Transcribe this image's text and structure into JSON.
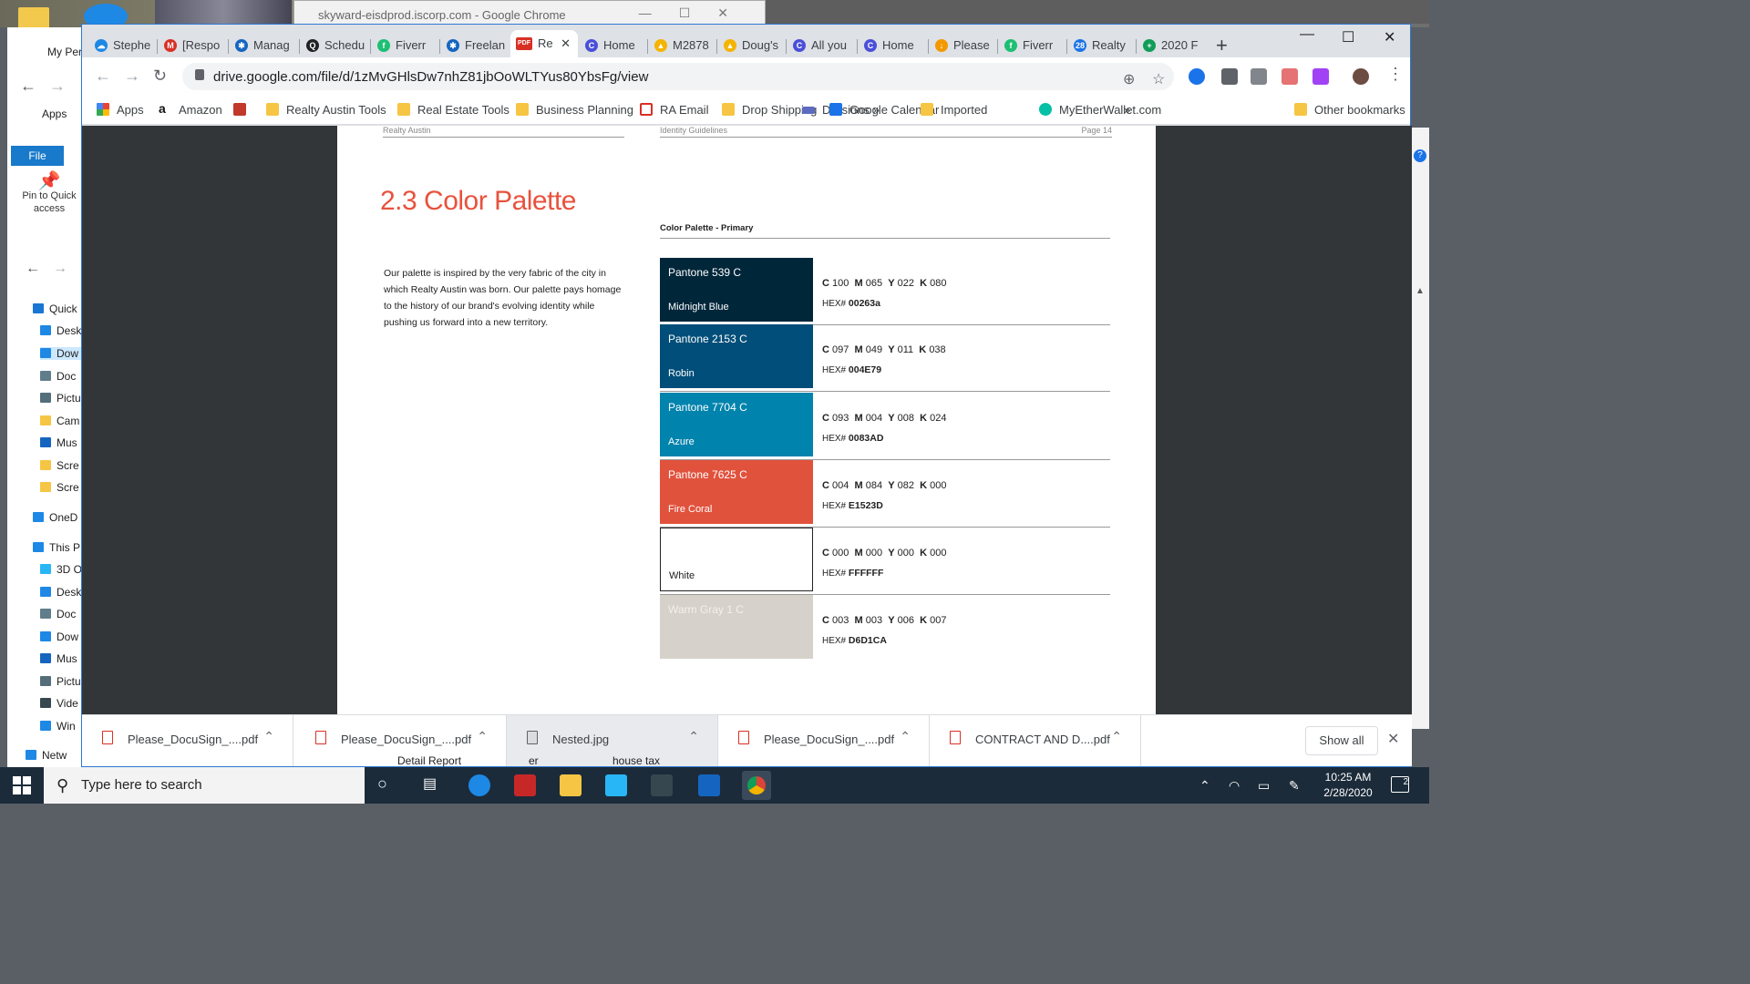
{
  "background_window": {
    "title": "skyward-eisdprod.iscorp.com - Google Chrome"
  },
  "explorer": {
    "file_tab": "File",
    "pin_label": "Pin to Quick access",
    "items": [
      "Quick",
      "Desk",
      "Dow",
      "Doc",
      "Pictu",
      "Cam",
      "Mus",
      "Scre",
      "Scre",
      "OneD",
      "This P",
      "3D O",
      "Desk",
      "Doc",
      "Dow",
      "Mus",
      "Pictu",
      "Vide",
      "Win",
      "Netw"
    ],
    "top_labels": [
      "My Per",
      "Apps"
    ]
  },
  "tabs": [
    {
      "label": "Stephe",
      "color": "#1e88e5",
      "glyph": "☁"
    },
    {
      "label": "[Respo",
      "color": "#d93025",
      "glyph": "M"
    },
    {
      "label": "Manag",
      "color": "#1565c0",
      "glyph": "✱"
    },
    {
      "label": "Schedu",
      "color": "#202124",
      "glyph": "Q"
    },
    {
      "label": "Fiverr",
      "color": "#1dbf73",
      "glyph": "f"
    },
    {
      "label": "Freelan",
      "color": "#1565c0",
      "glyph": "✱"
    },
    {
      "label": "Re",
      "color": "#d93025",
      "glyph": "PDF",
      "active": true
    },
    {
      "label": "Home",
      "color": "#4a4fd8",
      "glyph": "C"
    },
    {
      "label": "M2878",
      "color": "#f4b400",
      "glyph": "▲"
    },
    {
      "label": "Doug's",
      "color": "#f4b400",
      "glyph": "▲"
    },
    {
      "label": "All you",
      "color": "#4a4fd8",
      "glyph": "C"
    },
    {
      "label": "Home",
      "color": "#4a4fd8",
      "glyph": "C"
    },
    {
      "label": "Please",
      "color": "#f29900",
      "glyph": "↓"
    },
    {
      "label": "Fiverr",
      "color": "#1dbf73",
      "glyph": "f"
    },
    {
      "label": "Realty",
      "color": "#1a73e8",
      "glyph": "28"
    },
    {
      "label": "2020 F",
      "color": "#0f9d58",
      "glyph": "+"
    }
  ],
  "address_bar": {
    "url": "drive.google.com/file/d/1zMvGHlsDw7nhZ81jbOoWLTYus80YbsFg/view"
  },
  "bookmarks": [
    {
      "label": "Apps",
      "icon": "apps-grid"
    },
    {
      "label": "Amazon",
      "icon": "amazon"
    },
    {
      "label": "",
      "icon": "red-cube"
    },
    {
      "label": "Realty Austin Tools",
      "icon": "folder"
    },
    {
      "label": "Real Estate Tools",
      "icon": "folder"
    },
    {
      "label": "Business Planning",
      "icon": "folder"
    },
    {
      "label": "RA Email",
      "icon": "gmail"
    },
    {
      "label": "Drop Shipping",
      "icon": "folder"
    },
    {
      "label": "Divisions »",
      "icon": "divisions"
    },
    {
      "label": "Google Calendar",
      "icon": "calendar"
    },
    {
      "label": "Imported",
      "icon": "folder"
    },
    {
      "label": "MyEtherWallet.com",
      "icon": "mew"
    },
    {
      "label": "»",
      "icon": "none"
    },
    {
      "label": "Other bookmarks",
      "icon": "folder"
    }
  ],
  "document": {
    "header_left": "Realty Austin",
    "header_right": "Identity Guidelines",
    "page_number": "Page 14",
    "title": "2.3 Color Palette",
    "subtitle": "Color Palette - Primary",
    "intro": "Our palette is inspired by the very fabric of the city in which Realty Austin was born. Our palette pays homage to the history of our brand's evolving identity while pushing us forward into a new territory.",
    "swatches": [
      {
        "pantone": "Pantone 539 C",
        "name": "Midnight Blue",
        "c": "100",
        "m": "065",
        "y": "022",
        "k": "080",
        "hex": "00263a",
        "color": "#00263a",
        "text_color": "#ffffff"
      },
      {
        "pantone": "Pantone 2153 C",
        "name": "Robin",
        "c": "097",
        "m": "049",
        "y": "011",
        "k": "038",
        "hex": "004E79",
        "color": "#004e79",
        "text_color": "#ffffff"
      },
      {
        "pantone": "Pantone 7704 C",
        "name": "Azure",
        "c": "093",
        "m": "004",
        "y": "008",
        "k": "024",
        "hex": "0083AD",
        "color": "#0083ad",
        "text_color": "#ffffff"
      },
      {
        "pantone": "Pantone 7625 C",
        "name": "Fire Coral",
        "c": "004",
        "m": "084",
        "y": "082",
        "k": "000",
        "hex": "E1523D",
        "color": "#e1523d",
        "text_color": "#ffffff"
      },
      {
        "pantone": "",
        "name": "White",
        "c": "000",
        "m": "000",
        "y": "000",
        "k": "000",
        "hex": "FFFFFF",
        "color": "#ffffff",
        "text_color": "#222222"
      },
      {
        "pantone": "Warm Gray 1 C",
        "name": "",
        "c": "003",
        "m": "003",
        "y": "006",
        "k": "007",
        "hex": "D6D1CA",
        "color": "#d6d1ca",
        "text_color": "#f3f0ec"
      }
    ]
  },
  "downloads": [
    {
      "name": "Please_DocuSign_....pdf",
      "type": "pdf"
    },
    {
      "name": "Please_DocuSign_....pdf",
      "type": "pdf"
    },
    {
      "name": "Nested.jpg",
      "type": "image",
      "selected": true
    },
    {
      "name": "Please_DocuSign_....pdf",
      "type": "pdf"
    },
    {
      "name": "CONTRACT AND D....pdf",
      "type": "pdf"
    }
  ],
  "download_bar": {
    "show_all": "Show all"
  },
  "behind_taskbar_text": [
    "Detail Report",
    "er",
    "house tax"
  ],
  "taskbar": {
    "search_placeholder": "Type here to search",
    "time": "10:25 AM",
    "date": "2/28/2020",
    "notification_count": "2"
  }
}
